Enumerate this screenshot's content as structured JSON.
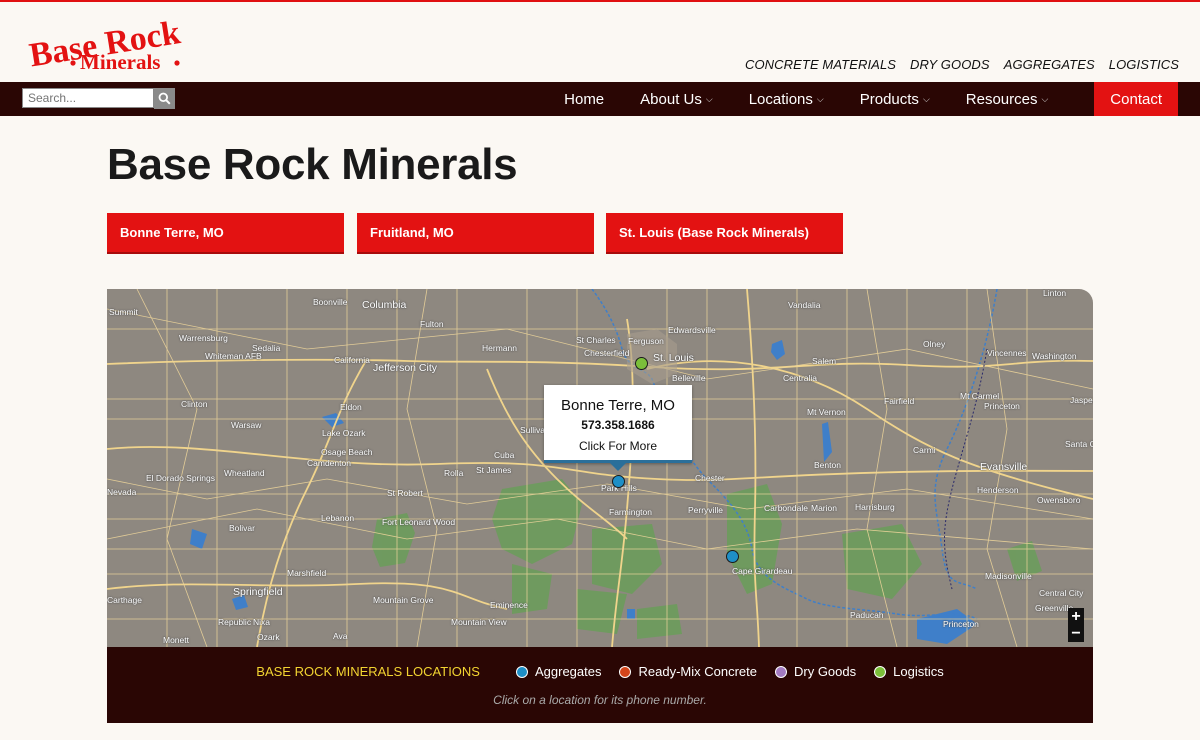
{
  "brand": {
    "logo_line1": "Base Rock",
    "logo_line2": "Minerals",
    "accent_color": "#e31212",
    "dark_color": "#2a0604"
  },
  "header": {
    "top_links": [
      "CONCRETE MATERIALS",
      "DRY GOODS",
      "AGGREGATES",
      "LOGISTICS"
    ],
    "search_placeholder": "Search..."
  },
  "nav": {
    "items": [
      {
        "label": "Home",
        "has_dropdown": false
      },
      {
        "label": "About Us",
        "has_dropdown": true
      },
      {
        "label": "Locations",
        "has_dropdown": true
      },
      {
        "label": "Products",
        "has_dropdown": true
      },
      {
        "label": "Resources",
        "has_dropdown": true
      }
    ],
    "contact_label": "Contact"
  },
  "page": {
    "title": "Base Rock Minerals",
    "location_buttons": [
      "Bonne Terre, MO",
      "Fruitland, MO",
      "St. Louis (Base Rock Minerals)"
    ]
  },
  "map": {
    "places": [
      "Summit",
      "Boonville",
      "Columbia",
      "Warrensburg",
      "Sedalia",
      "Whiteman AFB",
      "Fulton",
      "Hermann",
      "California",
      "Jefferson City",
      "St Charles",
      "Ferguson",
      "Chesterfield",
      "St. Louis",
      "Edwardsville",
      "Belleville",
      "Vandalia",
      "Olney",
      "Vincennes",
      "Washington",
      "Linton",
      "Salem",
      "Centralia",
      "Clinton",
      "Eldon",
      "Warsaw",
      "Lake Ozark",
      "Osage Beach",
      "Camdenton",
      "Sullivan",
      "Cuba",
      "Rolla",
      "St James",
      "Mt Vernon",
      "Fairfield",
      "Mt Carmel",
      "Princeton",
      "Jasper",
      "Santa Cl",
      "Carmi",
      "Evansville",
      "Henderson",
      "Owensboro",
      "Benton",
      "Chester",
      "Park Hills",
      "Farmington",
      "Perryville",
      "Carbondale",
      "Marion",
      "Harrisburg",
      "El Dorado Springs",
      "Wheatland",
      "Nevada",
      "Bolivar",
      "Lebanon",
      "St Robert",
      "Fort Leonard Wood",
      "Marshfield",
      "Springfield",
      "Carthage",
      "Republic",
      "Nixa",
      "Ozark",
      "Monett",
      "Ava",
      "Mountain Grove",
      "Mountain View",
      "Eminence",
      "Cape Girardeau",
      "Paducah",
      "Madisonville",
      "Central City",
      "Greenville",
      "Princeton"
    ],
    "popup": {
      "title": "Bonne Terre, MO",
      "phone": "573.358.1686",
      "link": "Click For More"
    },
    "markers": [
      {
        "name": "St. Louis",
        "type": "Logistics"
      },
      {
        "name": "Bonne Terre",
        "type": "Aggregates"
      },
      {
        "name": "Cape Girardeau",
        "type": "Aggregates"
      }
    ],
    "zoom_in": "+",
    "zoom_out": "−"
  },
  "legend": {
    "title": "BASE ROCK MINERALS LOCATIONS",
    "items": [
      {
        "label": "Aggregates",
        "color": "#1e8fc7"
      },
      {
        "label": "Ready-Mix Concrete",
        "color": "#d4451b"
      },
      {
        "label": "Dry Goods",
        "color": "#a37bc2"
      },
      {
        "label": "Logistics",
        "color": "#7bbf3a"
      }
    ],
    "hint": "Click on a location for its phone number."
  }
}
